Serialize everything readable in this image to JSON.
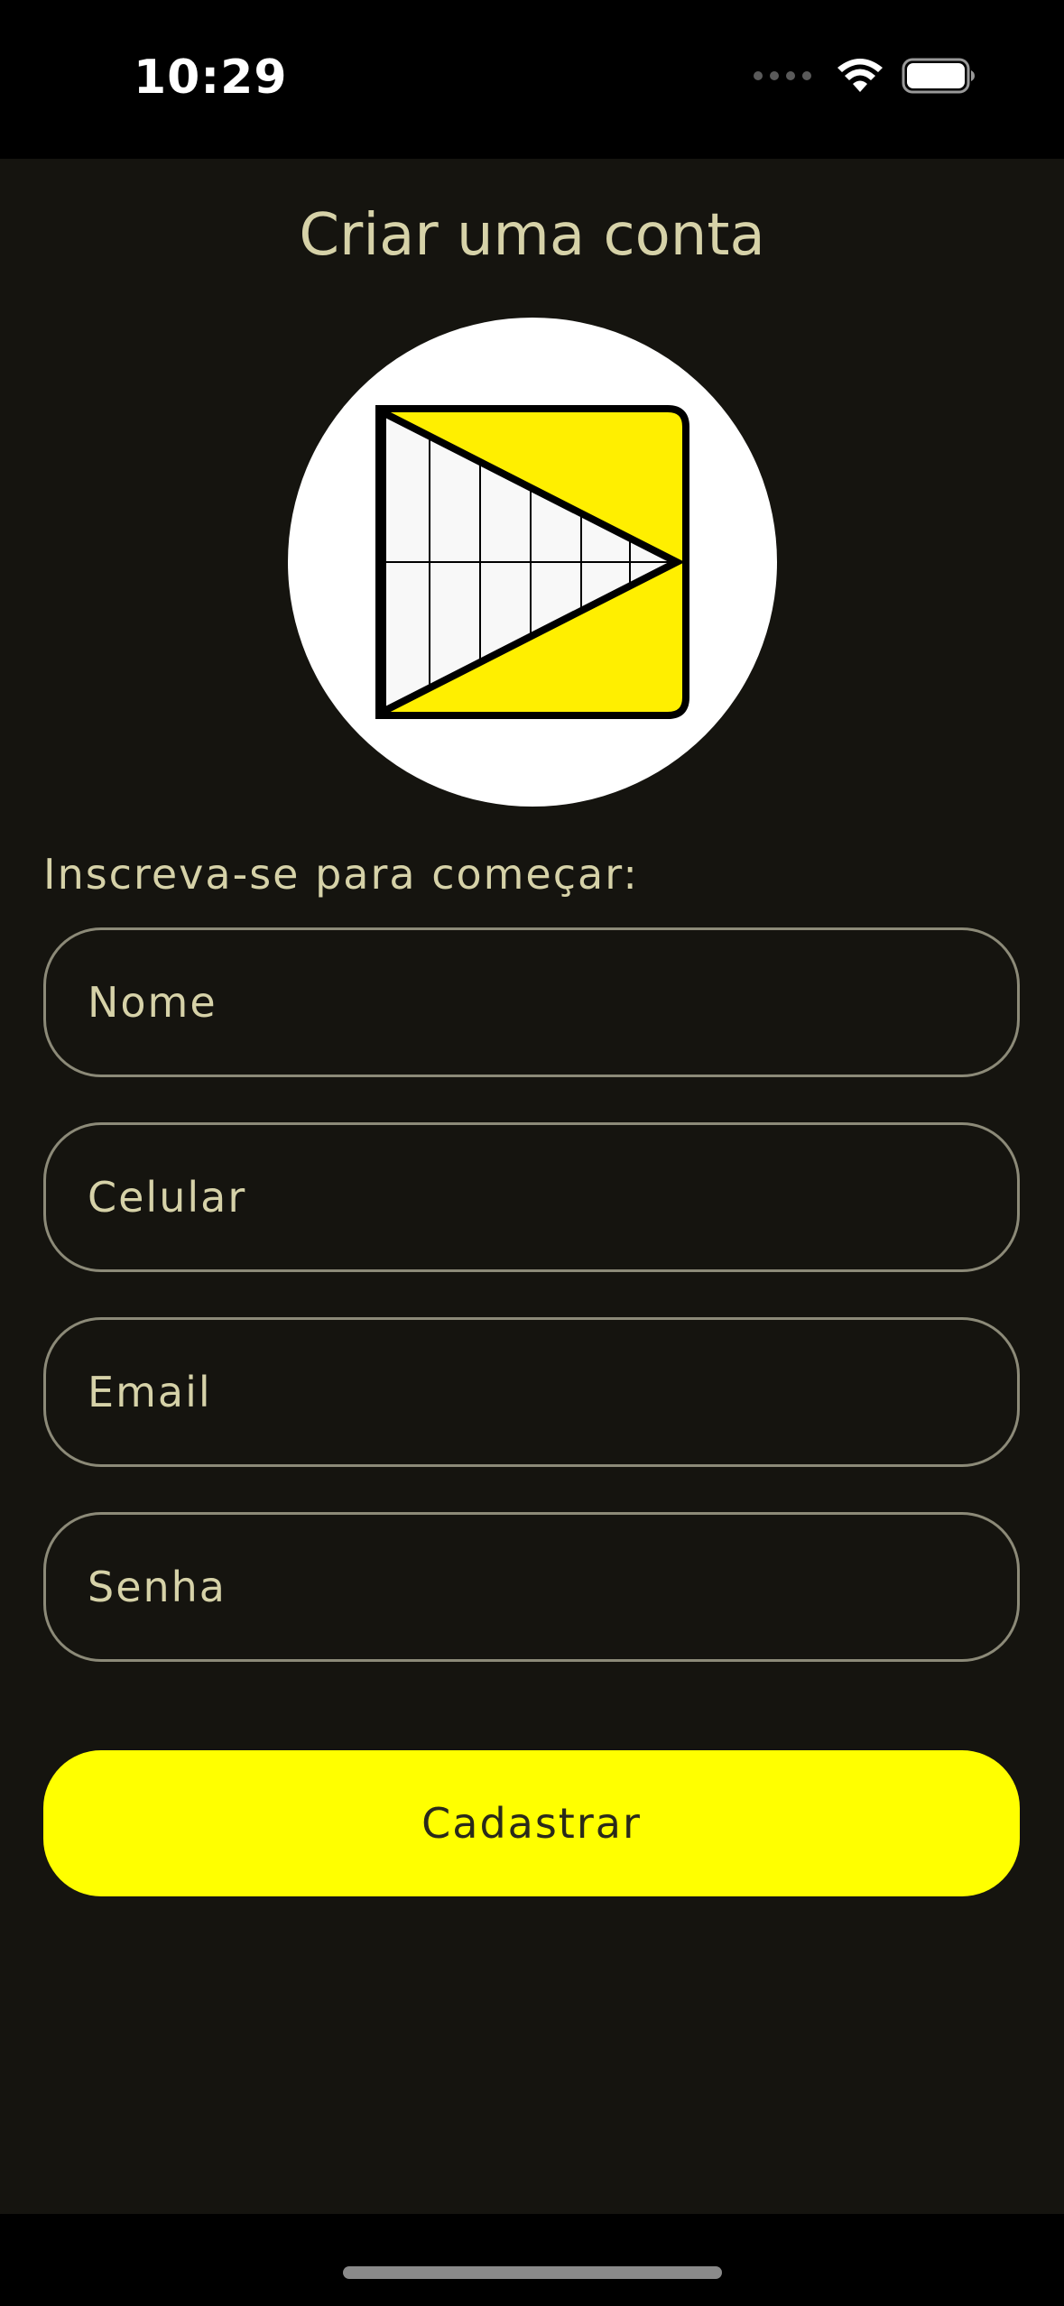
{
  "status_bar": {
    "time": "10:29"
  },
  "page": {
    "title": "Criar uma conta",
    "subtitle": "Inscreva-se para começar:"
  },
  "form": {
    "name_placeholder": "Nome",
    "phone_placeholder": "Celular",
    "email_placeholder": "Email",
    "password_placeholder": "Senha",
    "submit_label": "Cadastrar"
  },
  "colors": {
    "background": "#15140f",
    "accent": "#ffff00",
    "text": "#d6d2a8",
    "border": "#8c8a78"
  },
  "icons": {
    "logo": "app-logo-icon",
    "wifi": "wifi-icon",
    "battery": "battery-icon",
    "signal": "cellular-signal-icon"
  }
}
